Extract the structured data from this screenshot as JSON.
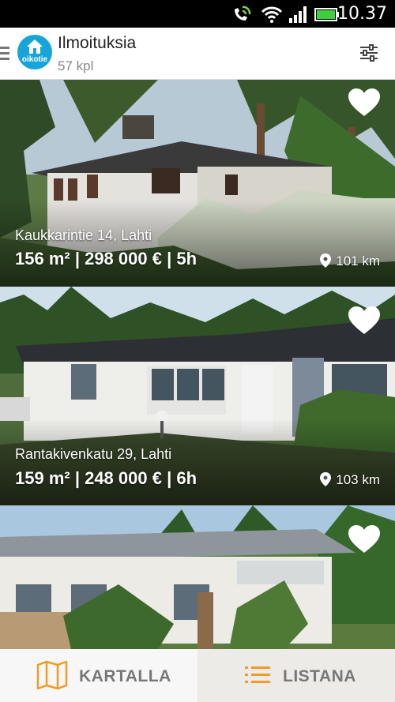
{
  "status_bar": {
    "time": "10.37",
    "icons": [
      "phone-sync-icon",
      "wifi-icon",
      "signal-icon",
      "battery-icon"
    ]
  },
  "app_bar": {
    "logo_text": "oikotie",
    "title": "Ilmoituksia",
    "count": "57 kpl",
    "icons": [
      "menu-icon",
      "filter-icon"
    ]
  },
  "listings": [
    {
      "address": "Kaukkarintie 14, Lahti",
      "info": "156 m² | 298 000 € | 5h",
      "distance": "101 km"
    },
    {
      "address": "Rantakivenkatu 29, Lahti",
      "info": "159 m² | 248 000 € | 6h",
      "distance": "103 km"
    },
    {
      "address": "",
      "info": "",
      "distance": ""
    }
  ],
  "bottom_nav": {
    "map_label": "KARTALLA",
    "list_label": "LISTANA"
  },
  "colors": {
    "brand": "#17a5d9",
    "accent_orange": "#f39a26",
    "tab_text": "#777777"
  }
}
